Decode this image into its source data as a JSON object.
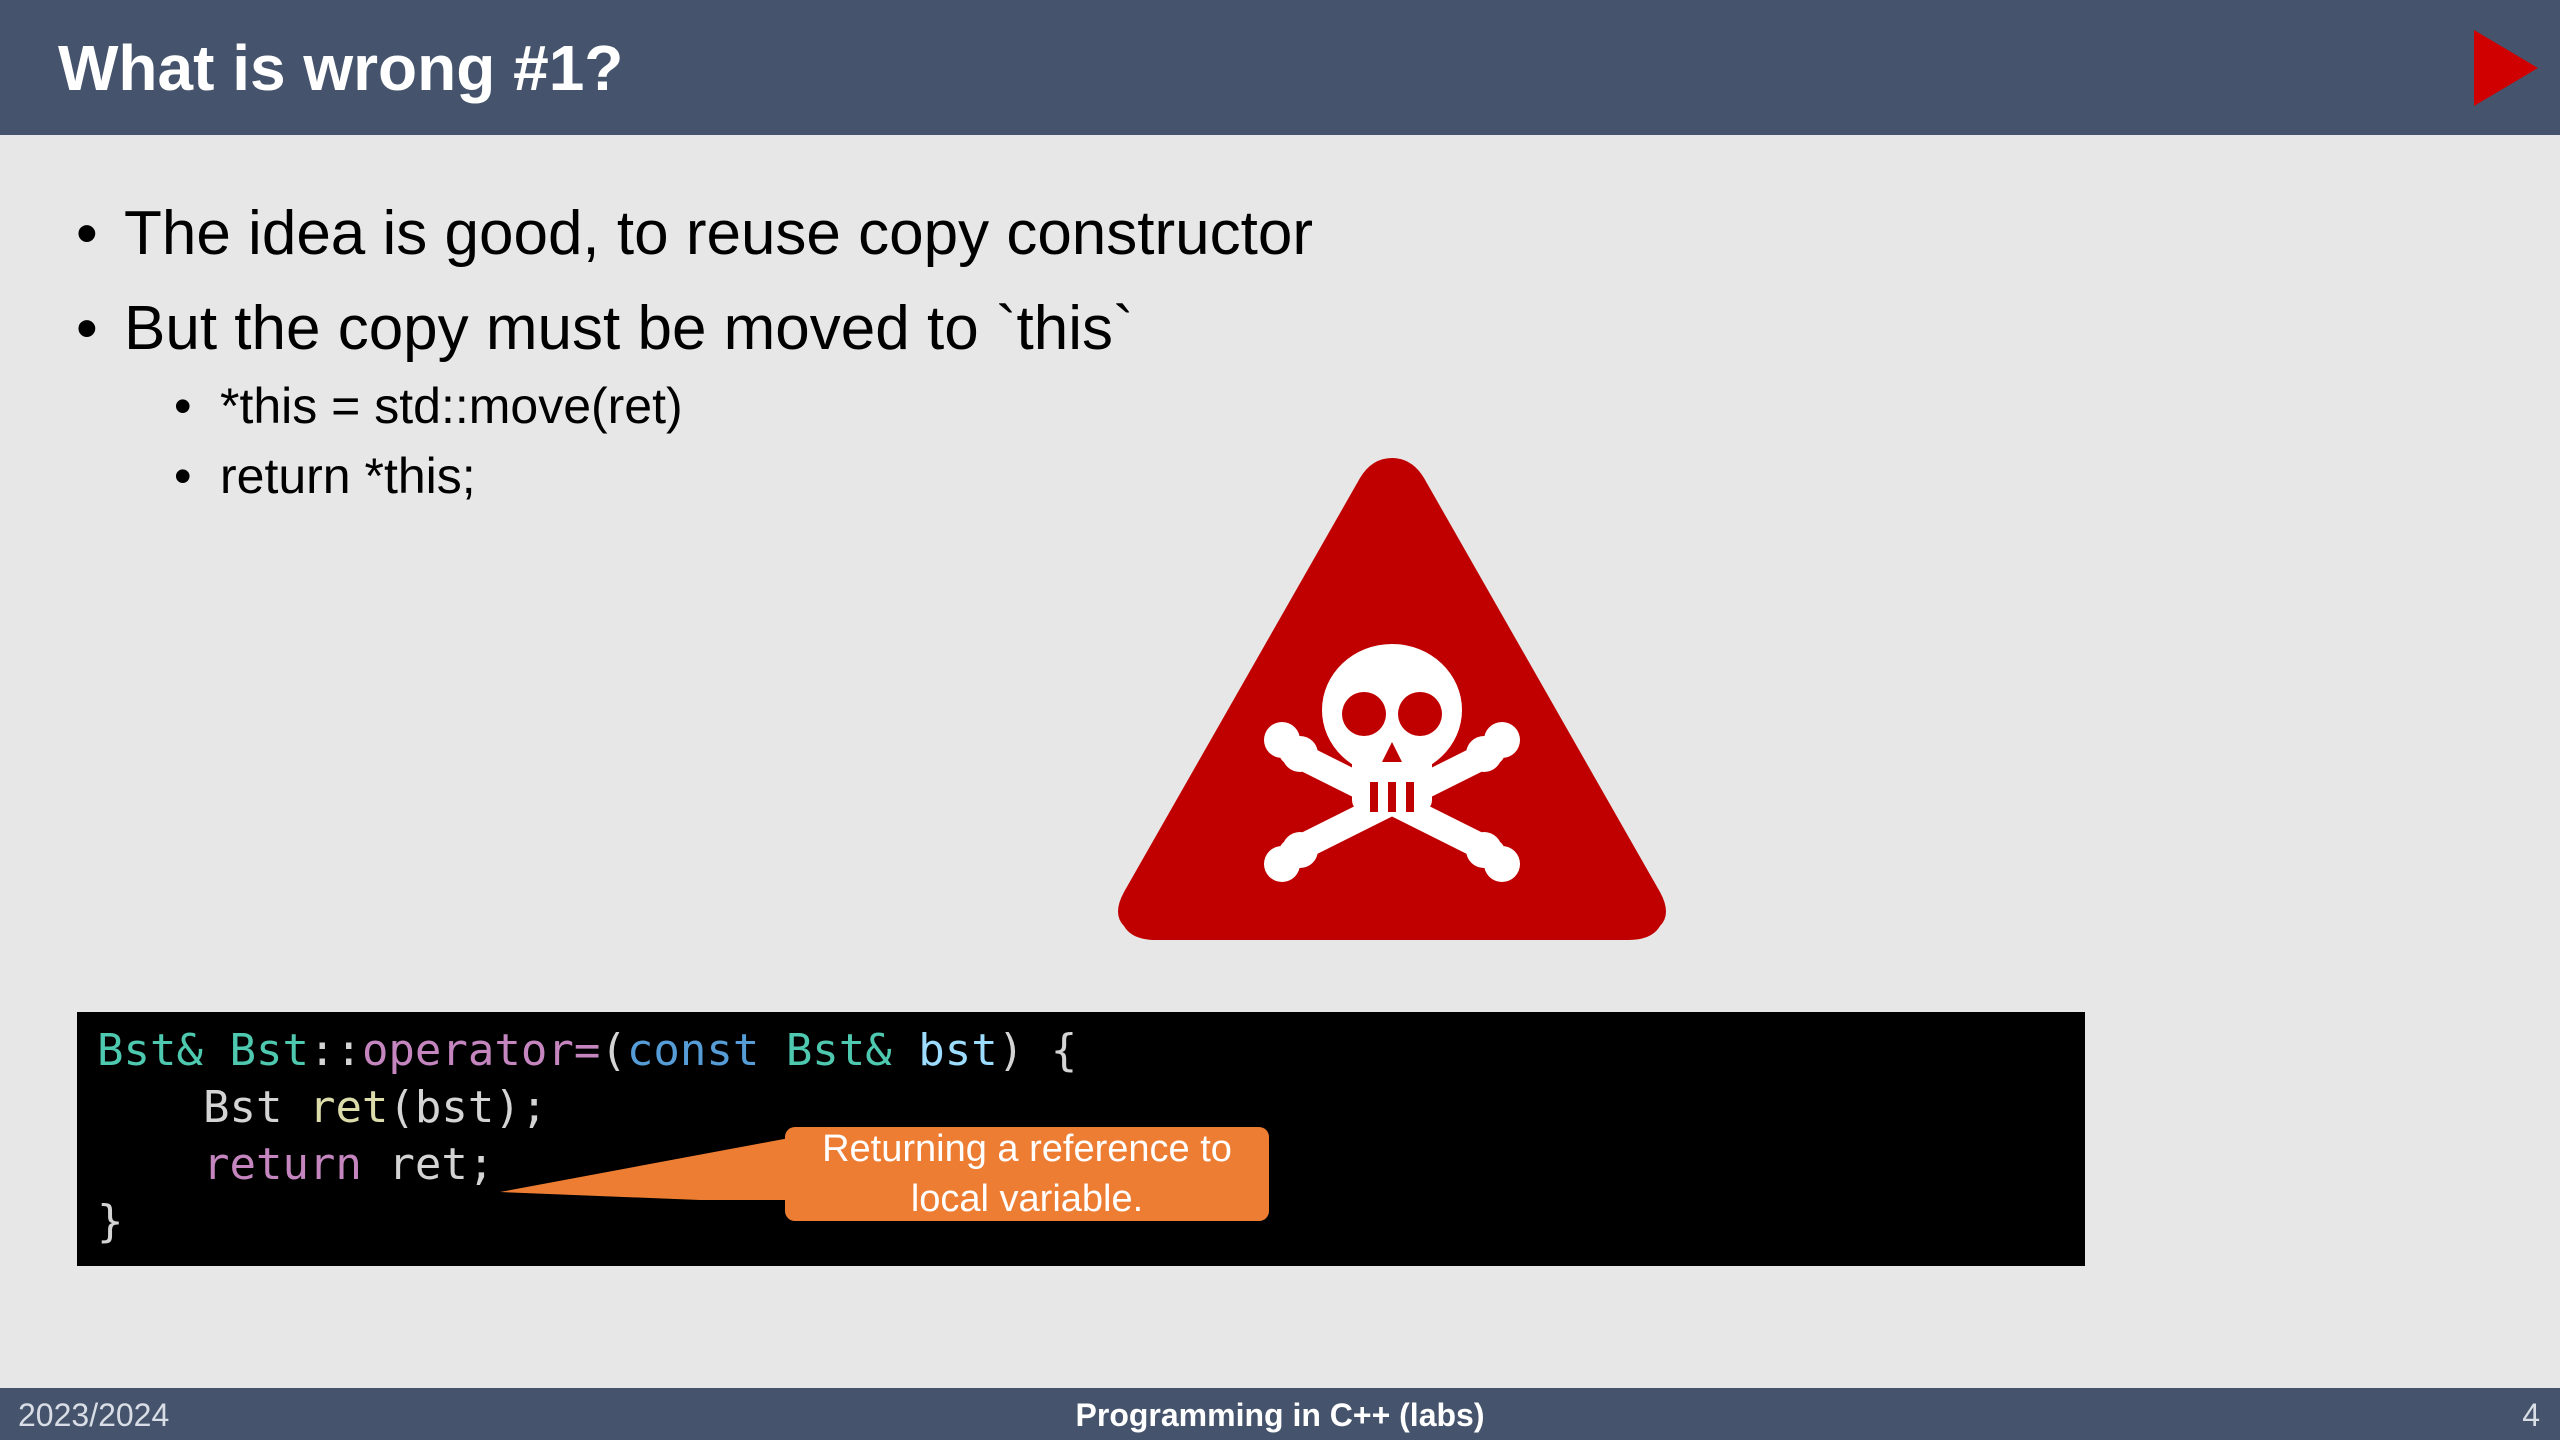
{
  "slide": {
    "title": "What is wrong #1?",
    "bullets": [
      {
        "text": "The idea is good, to reuse copy constructor",
        "level": 1
      },
      {
        "text": "But the copy must be moved to `this`",
        "level": 1,
        "children": [
          {
            "text": "*this = std::move(ret)",
            "level": 2
          },
          {
            "text": "return *this;",
            "level": 2
          }
        ]
      }
    ],
    "bullet_glyph": "•",
    "warning_icon": "skull-crossbones-warning-icon",
    "code": {
      "line1": {
        "t1": "Bst&",
        "t2": " ",
        "t3": "Bst",
        "t4": "::",
        "t5": "operator=",
        "t6": "(",
        "t7": "const",
        "t8": " ",
        "t9": "Bst&",
        "t10": " ",
        "t11": "bst",
        "t12": ") {"
      },
      "line2": {
        "indent": "    ",
        "t1": "Bst",
        "t2": " ",
        "t3": "ret",
        "t4": "(bst);"
      },
      "line3": {
        "indent": "    ",
        "t1": "return",
        "t2": " ret;"
      },
      "line4": {
        "t1": "}"
      }
    },
    "callout": {
      "line1": "Returning a reference to",
      "line2": "local variable."
    }
  },
  "footer": {
    "left": "2023/2024",
    "center": "Programming in C++ (labs)",
    "page_number": "4"
  },
  "colors": {
    "header_bg": "#45546c",
    "slide_bg": "#e7e7e7",
    "accent_red": "#c00000",
    "callout_orange": "#ee7d34",
    "code_bg": "#000000"
  }
}
